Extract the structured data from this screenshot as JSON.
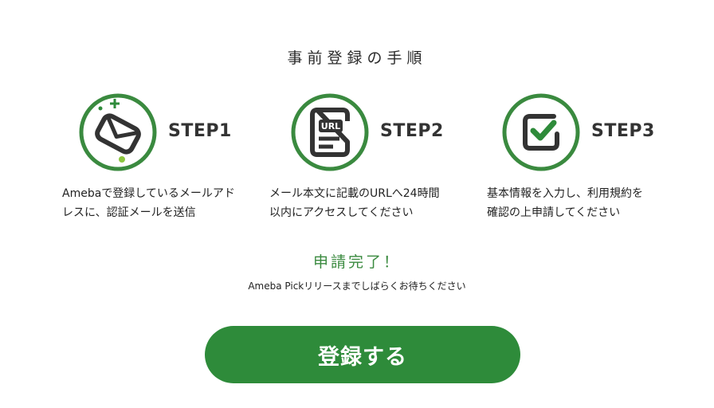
{
  "title": "事前登録の手順",
  "steps": [
    {
      "label": "STEP1",
      "icon": "mail-envelope-icon",
      "desc_line1": "Amebaで登録しているメールアド",
      "desc_line2": "レスに、認証メールを送信"
    },
    {
      "label": "STEP2",
      "icon": "url-document-icon",
      "desc_line1": "メール本文に記載のURLへ24時間",
      "desc_line2": "以内にアクセスしてください"
    },
    {
      "label": "STEP3",
      "icon": "checkbox-icon",
      "desc_line1": "基本情報を入力し、利用規約を",
      "desc_line2": "確認の上申請してください"
    }
  ],
  "url_badge": "URL",
  "complete_title": "申請完了！",
  "wait_text": "Ameba Pickリリースまでしばらくお待ちください",
  "register_button": "登録する",
  "colors": {
    "brand_green": "#2e8b3a",
    "ring_green": "#3a8a3f",
    "icon_dark": "#333333",
    "accent_lime": "#8cc63f"
  }
}
